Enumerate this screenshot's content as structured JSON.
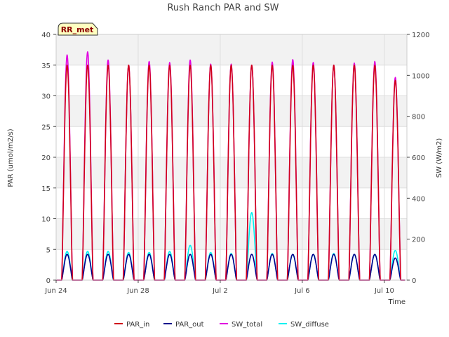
{
  "chart_data": {
    "type": "line",
    "title": "Rush Ranch PAR and SW",
    "site_badge": "RR_met",
    "xlabel": "Time",
    "ylabel_left": "PAR (umol/m2/s)",
    "ylabel_right": "SW (W/m2)",
    "ylim_left": [
      0,
      40
    ],
    "ylim_right": [
      0,
      1200
    ],
    "yticks_left": [
      "0",
      "5",
      "10",
      "15",
      "20",
      "25",
      "30",
      "35",
      "40"
    ],
    "yticks_right": [
      "0",
      "200",
      "400",
      "600",
      "800",
      "1000",
      "1200"
    ],
    "x_start_day": 0,
    "x_end_day": 17.1,
    "xticks": [
      {
        "day": 0,
        "label": "Jun 24"
      },
      {
        "day": 4,
        "label": "Jun 28"
      },
      {
        "day": 8,
        "label": "Jul 2"
      },
      {
        "day": 12,
        "label": "Jul 6"
      },
      {
        "day": 16,
        "label": "Jul 10"
      }
    ],
    "grid": true,
    "legend_position": "bottom",
    "day_count": 17,
    "series": [
      {
        "name": "PAR_in",
        "color": "#d0001a",
        "axis": "left",
        "daily_peaks": [
          35,
          35,
          35,
          35,
          35,
          35,
          35,
          35,
          35,
          35,
          35,
          35,
          35,
          35,
          35,
          35,
          32.5
        ]
      },
      {
        "name": "PAR_out",
        "color": "#00008b",
        "axis": "left",
        "daily_peaks": [
          4.2,
          4.2,
          4.2,
          4.2,
          4.2,
          4.2,
          4.2,
          4.2,
          4.2,
          4.2,
          4.2,
          4.2,
          4.2,
          4.2,
          4.2,
          4.2,
          3.6
        ]
      },
      {
        "name": "SW_total",
        "color": "#e000e0",
        "axis": "right",
        "daily_peaks": [
          1100,
          1115,
          1075,
          1050,
          1068,
          1063,
          1075,
          1055,
          1055,
          1050,
          1065,
          1077,
          1063,
          1050,
          1060,
          1068,
          990
        ]
      },
      {
        "name": "SW_diffuse",
        "color": "#00f0f0",
        "axis": "right",
        "daily_peaks": [
          140,
          140,
          140,
          135,
          135,
          140,
          170,
          135,
          130,
          330,
          130,
          125,
          125,
          130,
          125,
          125,
          145
        ]
      }
    ]
  }
}
